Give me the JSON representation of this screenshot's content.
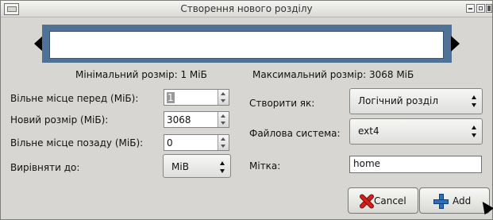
{
  "window": {
    "title": "Створення нового розділу"
  },
  "partition_bar": {
    "min_size_label": "Мінімальний розмір: 1 МіБ",
    "max_size_label": "Максимальний розмір: 3068 МіБ"
  },
  "left_fields": {
    "free_before_label": "Вільне місце перед (МіБ):",
    "free_before_value": "1",
    "new_size_label": "Новий розмір (МіБ):",
    "new_size_value": "3068",
    "free_after_label": "Вільне місце позаду (МіБ):",
    "free_after_value": "0",
    "align_label": "Вирівняти до:",
    "align_value": "MiB"
  },
  "right_fields": {
    "create_as_label": "Створити як:",
    "create_as_value": "Логічний розділ",
    "filesystem_label": "Файлова система:",
    "filesystem_value": "ext4",
    "label_label": "Мітка:",
    "label_value": "home"
  },
  "buttons": {
    "cancel_label": "Cancel",
    "add_label": "Add"
  },
  "icons": {
    "app": "app-icon",
    "minimize": "minimize-icon",
    "maximize": "maximize-icon",
    "close": "close-icon",
    "cancel": "cancel-icon",
    "add": "add-icon"
  }
}
